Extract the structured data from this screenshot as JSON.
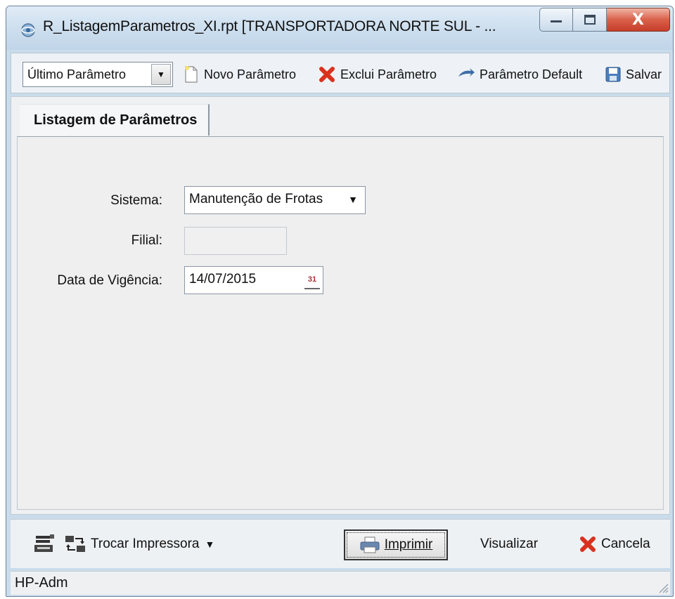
{
  "window": {
    "title": "R_ListagemParametros_XI.rpt [TRANSPORTADORA NORTE SUL - ...",
    "close_label": "X"
  },
  "toolbar": {
    "param_select_value": "Último Parâmetro",
    "novo_label": "Novo Parâmetro",
    "exclui_label": "Exclui Parâmetro",
    "default_label": "Parâmetro Default",
    "salvar_label": "Salvar"
  },
  "tabs": [
    {
      "label": "Listagem de Parâmetros",
      "active": true
    }
  ],
  "form": {
    "sistema_label": "Sistema:",
    "sistema_value": "Manutenção de Frotas",
    "filial_label": "Filial:",
    "filial_value": "",
    "data_label": "Data de Vigência:",
    "data_value": "14/07/2015"
  },
  "footer": {
    "trocar_label": "Trocar Impressora",
    "imprimir_label": "Imprimir",
    "visualizar_label": "Visualizar",
    "cancela_label": "Cancela"
  },
  "status": {
    "printer": "HP-Adm"
  },
  "colors": {
    "title_gradient_top": "#e0ecf7",
    "close_button": "#c63f2a",
    "panel_bg": "#efefef"
  }
}
